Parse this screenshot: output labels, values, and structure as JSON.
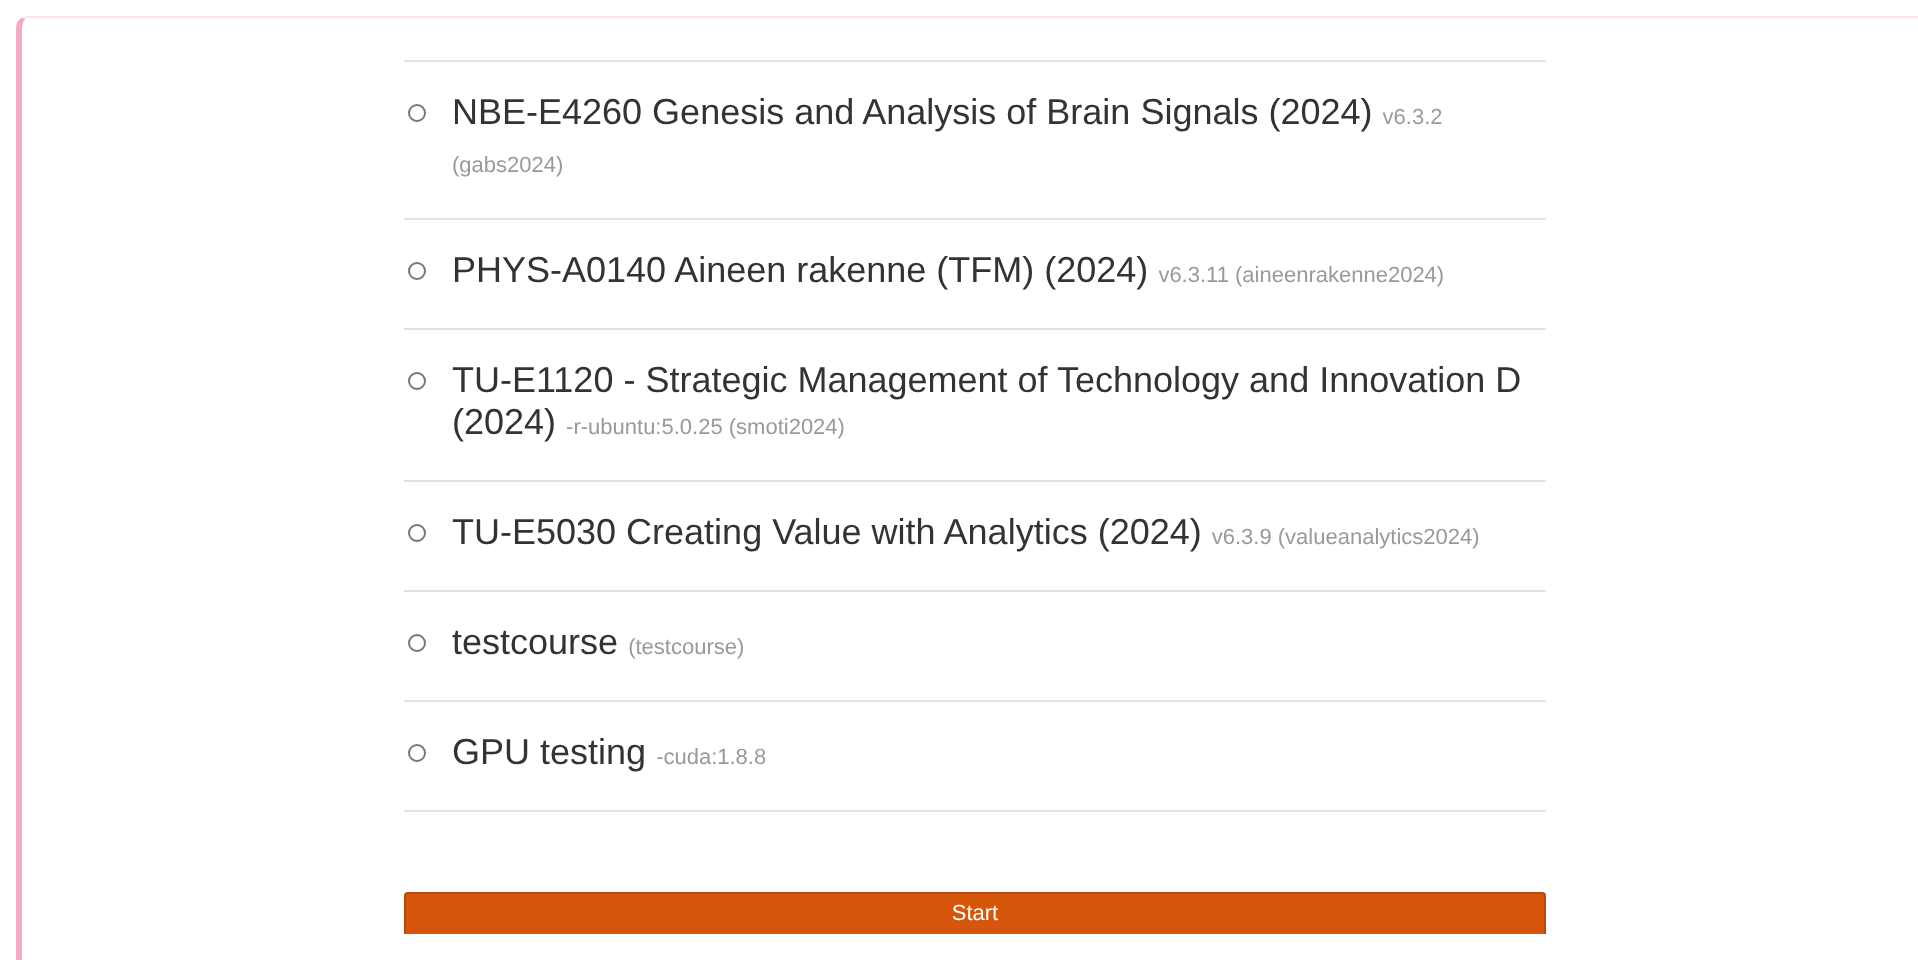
{
  "courses": [
    {
      "title": "NBE-E4260 Genesis and Analysis of Brain Signals (2024)",
      "meta": "v6.3.2 (gabs2024)",
      "selected": false
    },
    {
      "title": "PHYS-A0140 Aineen rakenne (TFM) (2024)",
      "meta": "v6.3.11 (aineenrakenne2024)",
      "selected": false
    },
    {
      "title": "TU-E1120 - Strategic Management of Technology and Innovation D (2024)",
      "meta": "-r-ubuntu:5.0.25 (smoti2024)",
      "selected": false
    },
    {
      "title": "TU-E5030 Creating Value with Analytics (2024)",
      "meta": "v6.3.9 (valueanalytics2024)",
      "selected": false
    },
    {
      "title": "testcourse",
      "meta": "(testcourse)",
      "selected": false
    },
    {
      "title": "GPU testing",
      "meta": "-cuda:1.8.8",
      "selected": false
    }
  ],
  "start_button": "Start"
}
